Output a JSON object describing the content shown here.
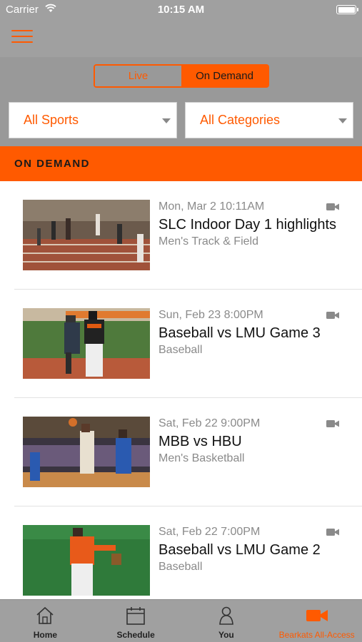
{
  "status_bar": {
    "carrier": "Carrier",
    "time": "10:15 AM"
  },
  "nav": {
    "menu_icon": "hamburger-icon"
  },
  "segments": {
    "live": "Live",
    "on_demand": "On Demand",
    "selected": "On Demand"
  },
  "filters": {
    "sports": "All Sports",
    "categories": "All Categories"
  },
  "section": {
    "title": "ON DEMAND"
  },
  "videos": [
    {
      "date": "Mon, Mar 2 10:11AM",
      "title": "SLC Indoor Day 1 highlights",
      "category": "Men's Track & Field",
      "icon": "video-camera-icon"
    },
    {
      "date": "Sun, Feb 23 8:00PM",
      "title": "Baseball vs LMU Game 3",
      "category": "Baseball",
      "icon": "video-camera-icon"
    },
    {
      "date": "Sat, Feb 22 9:00PM",
      "title": "MBB vs HBU",
      "category": "Men's Basketball",
      "icon": "video-camera-icon"
    },
    {
      "date": "Sat, Feb 22 7:00PM",
      "title": "Baseball vs LMU Game 2",
      "category": "Baseball",
      "icon": "video-camera-icon"
    }
  ],
  "tabs": [
    {
      "label": "Home",
      "icon": "home-icon"
    },
    {
      "label": "Schedule",
      "icon": "calendar-icon"
    },
    {
      "label": "You",
      "icon": "person-icon"
    },
    {
      "label": "Bearkats All-Access",
      "icon": "video-camera-icon",
      "active": true
    }
  ],
  "colors": {
    "accent": "#ff5a00",
    "bar_gray": "#a0a0a0",
    "controls_gray": "#999999"
  }
}
